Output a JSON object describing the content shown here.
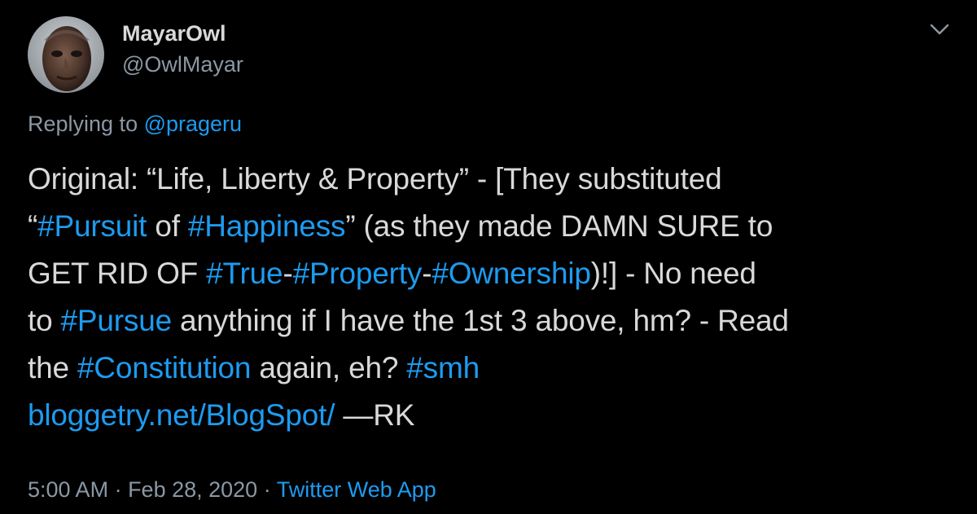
{
  "author": {
    "display_name": "MayarOwl",
    "handle": "@OwlMayar"
  },
  "menu_icon": "chevron-down-icon",
  "reply": {
    "prefix": "Replying to ",
    "mention": "@prageru"
  },
  "tweet_text": {
    "l1_a": "Original: “Life, Liberty & Property” - [They substituted",
    "l2_a": "“",
    "l2_tag1": "#Pursuit",
    "l2_b": " of ",
    "l2_tag2": "#Happiness",
    "l2_c": "” (as they made DAMN SURE to",
    "l3_a": "GET RID OF ",
    "l3_tag1": "#True",
    "l3_b": "-",
    "l3_tag2": "#Property",
    "l3_c": "-",
    "l3_tag3": "#Ownership",
    "l3_d": ")!] - No need",
    "l4_a": "to ",
    "l4_tag1": "#Pursue",
    "l4_b": " anything if I have the 1st 3 above, hm? - Read",
    "l5_a": "the ",
    "l5_tag1": "#Constitution",
    "l5_b": " again, eh? ",
    "l5_tag2": "#smh",
    "l6_link": "bloggetry.net/BlogSpot/",
    "l6_b": " —RK"
  },
  "meta": {
    "time": "5:00 AM",
    "sep1": " · ",
    "date": "Feb 28, 2020",
    "sep2": " · ",
    "source": "Twitter Web App"
  },
  "colors": {
    "background": "#000000",
    "text": "#d9d9d9",
    "secondary": "#8b98a5",
    "link": "#1d9bf0"
  }
}
